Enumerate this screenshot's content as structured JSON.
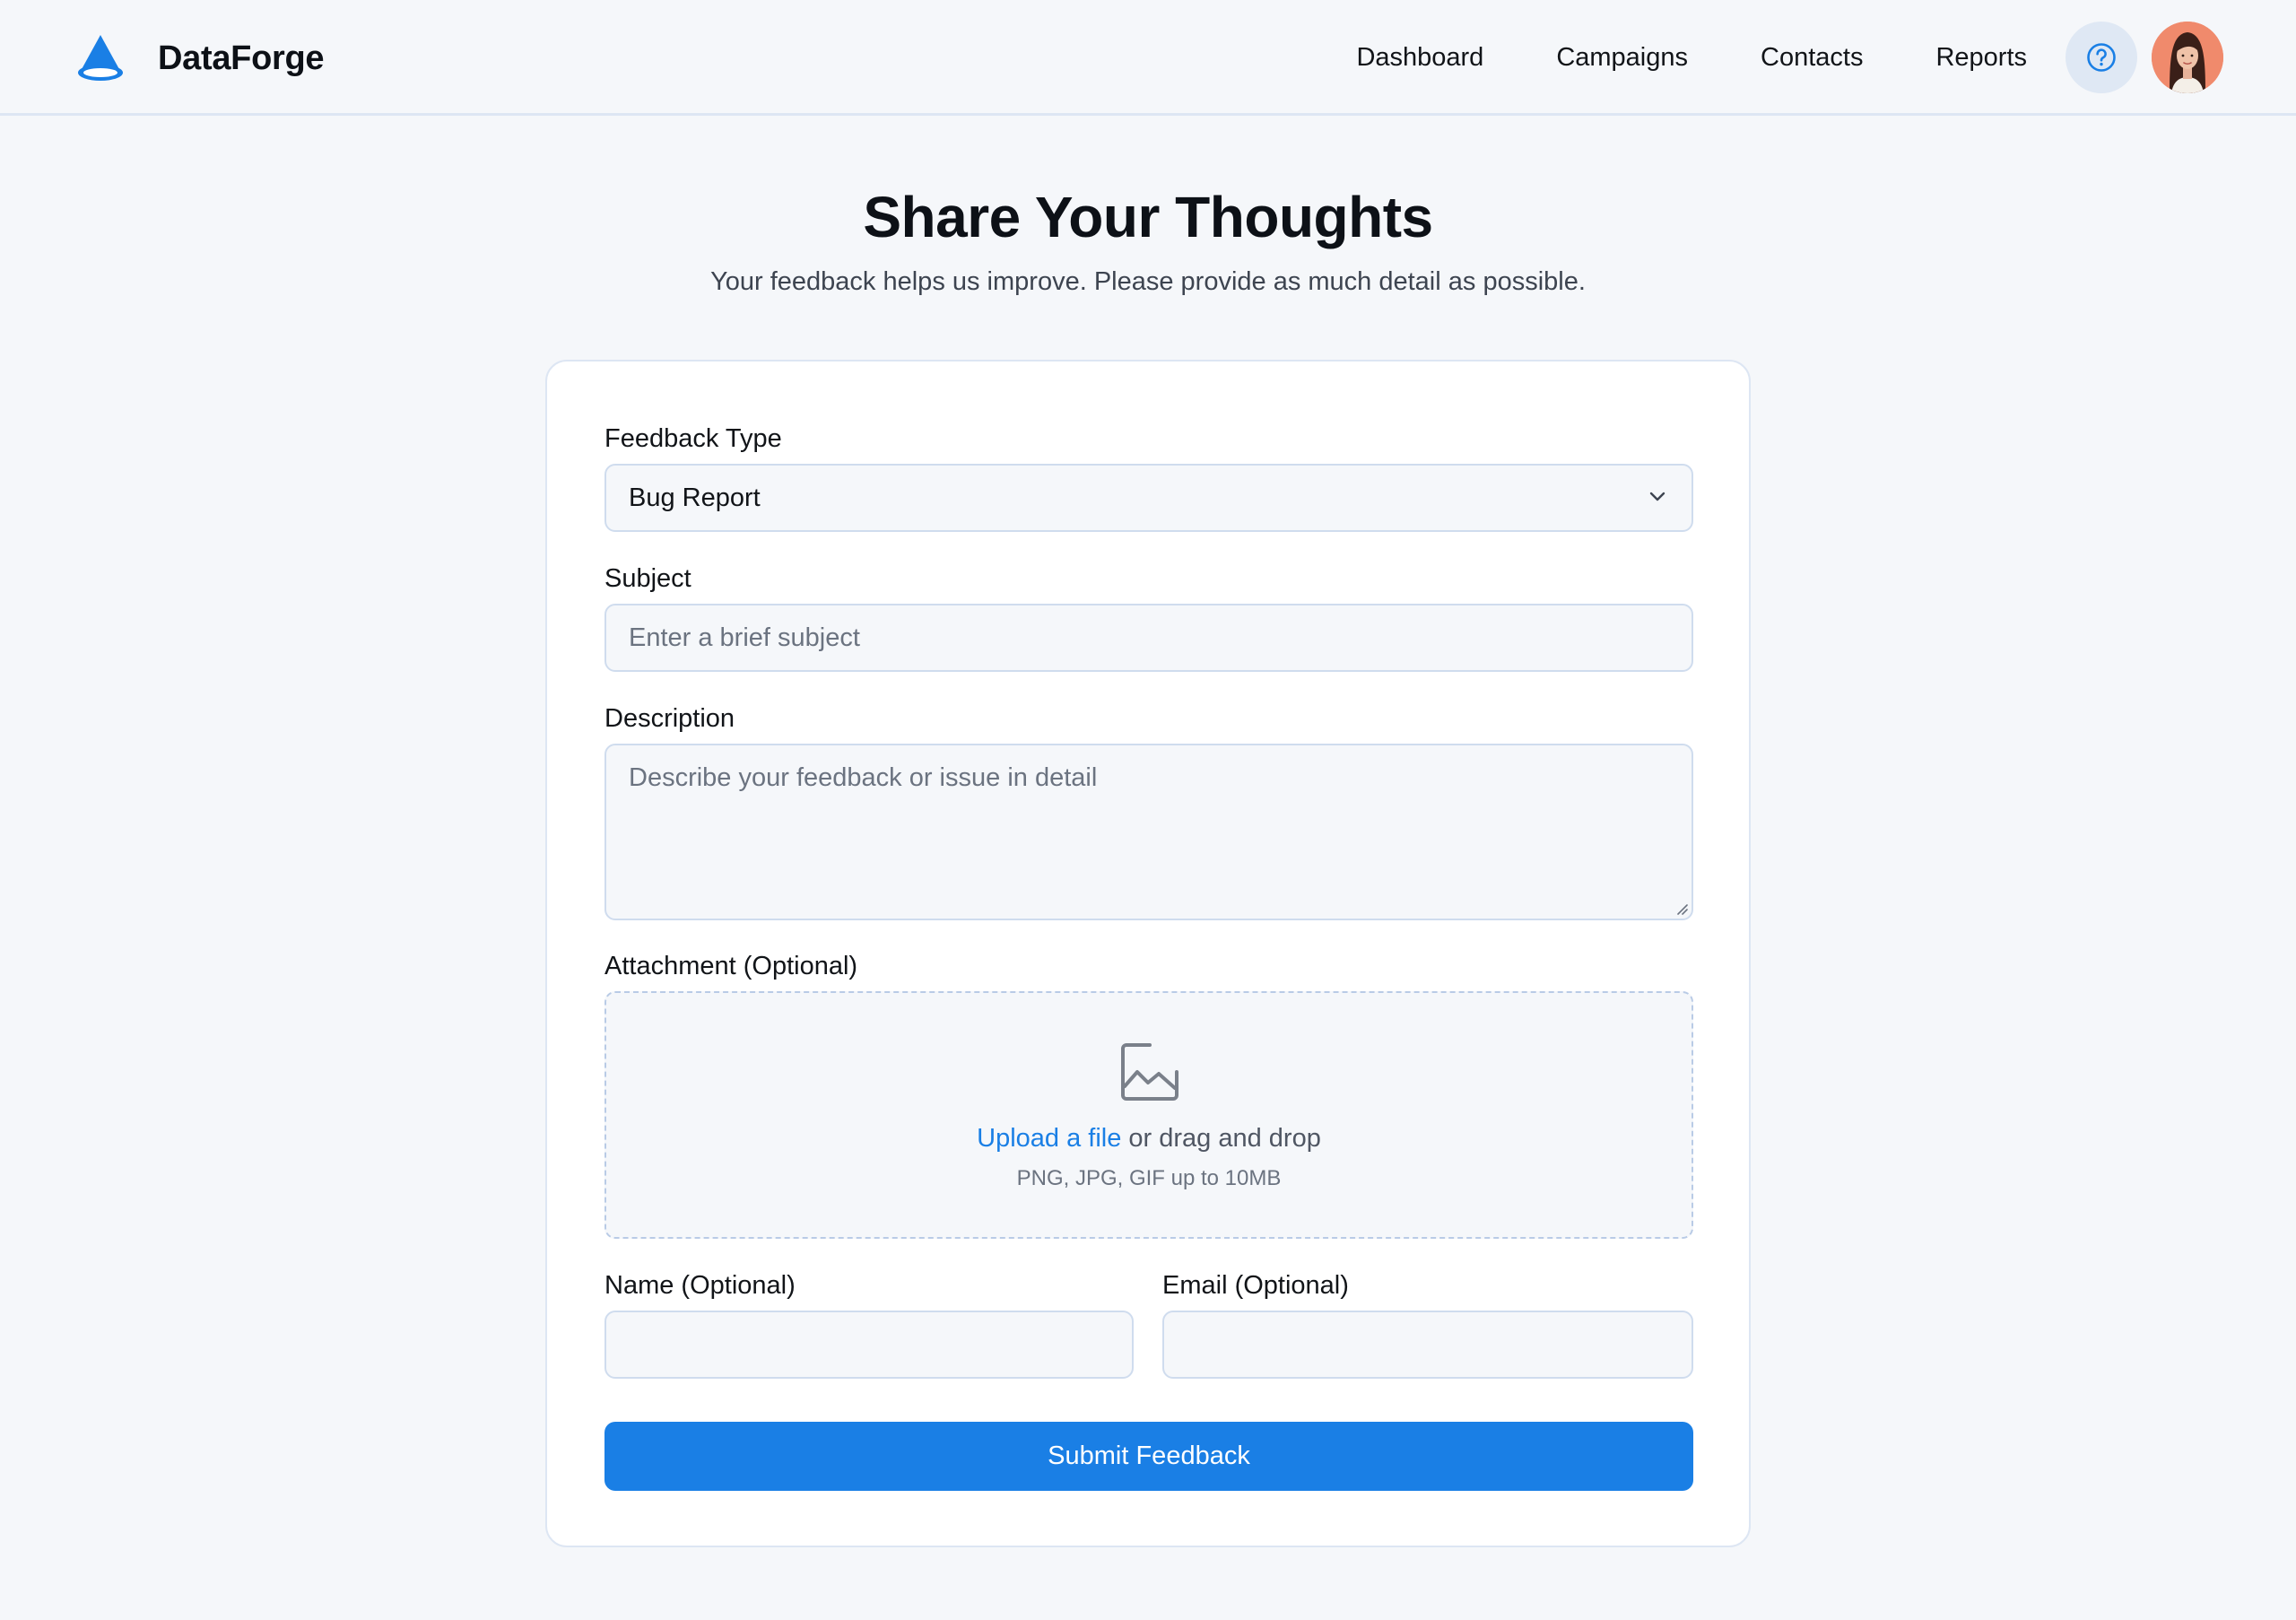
{
  "header": {
    "brand_name": "DataForge",
    "nav": [
      "Dashboard",
      "Campaigns",
      "Contacts",
      "Reports"
    ],
    "help_icon": "question-circle-icon",
    "avatar_icon": "user-avatar"
  },
  "hero": {
    "title": "Share Your Thoughts",
    "subtitle": "Your feedback helps us improve. Please provide as much detail as possible."
  },
  "form": {
    "feedback_type": {
      "label": "Feedback Type",
      "value": "Bug Report",
      "icon": "chevron-down-icon"
    },
    "subject": {
      "label": "Subject",
      "placeholder": "Enter a brief subject",
      "value": ""
    },
    "description": {
      "label": "Description",
      "placeholder": "Describe your feedback or issue in detail",
      "value": ""
    },
    "attachment": {
      "label": "Attachment (Optional)",
      "icon": "image-icon",
      "upload_link": "Upload a file",
      "upload_rest": "or drag and drop",
      "hint": "PNG, JPG, GIF up to 10MB"
    },
    "name": {
      "label": "Name (Optional)",
      "value": ""
    },
    "email": {
      "label": "Email (Optional)",
      "value": ""
    },
    "submit_label": "Submit Feedback"
  },
  "colors": {
    "accent": "#1a7fe5",
    "background": "#f5f7fa",
    "card": "#ffffff",
    "border": "#cfdcee",
    "help_bg": "#dfe8f4",
    "avatar_bg": "#f08a6c"
  }
}
